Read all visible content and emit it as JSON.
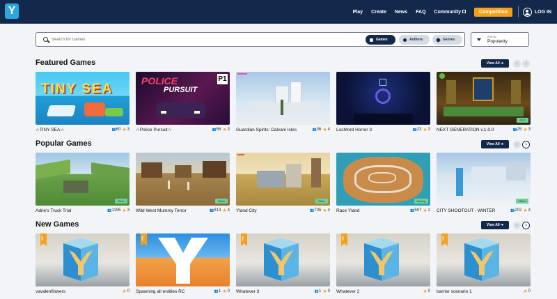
{
  "nav": {
    "logo_letter": "Y",
    "items": [
      "Play",
      "Create",
      "News",
      "FAQ",
      "Community"
    ],
    "competition": "Competition",
    "login": "LOG IN"
  },
  "search": {
    "placeholder": "Search for Games",
    "filters": [
      "Games",
      "Authors",
      "Genres"
    ],
    "sort_label": "Sort By",
    "sort_value": "Popularity"
  },
  "sections": [
    {
      "title": "Featured Games",
      "view_all": "View All ➔",
      "games": [
        {
          "title": "☆TINY SEA☆",
          "plays": "60",
          "rating": "3",
          "thumb": "tiny-sea"
        },
        {
          "title": "☆Police Pursuit☆",
          "plays": "56",
          "rating": "3",
          "thumb": "police"
        },
        {
          "title": "Guardian Spirits: Dalvani Isles",
          "plays": "36",
          "rating": "4",
          "thumb": "guardian"
        },
        {
          "title": "Lochford Horror 3",
          "plays": "23",
          "rating": "3",
          "thumb": "lochford"
        },
        {
          "title": "NEXT GENERATION v.1.0.0",
          "plays": "25",
          "rating": "3",
          "tag": "RPG",
          "thumb": "nextgen"
        }
      ]
    },
    {
      "title": "Popular Games",
      "view_all": "View All ➔",
      "games": [
        {
          "title": "Adrie's Truck Trial",
          "plays": "1195",
          "rating": "3",
          "tag": "Other",
          "thumb": "truck"
        },
        {
          "title": "Wild West Mummy Terror",
          "plays": "813",
          "rating": "4",
          "tag": "Other",
          "thumb": "wildwest"
        },
        {
          "title": "Yland City",
          "plays": "705",
          "rating": "4",
          "tag": "Other",
          "thumb": "ylandcity"
        },
        {
          "title": "Race Yland",
          "plays": "597",
          "rating": "2",
          "tag": "Racing",
          "thumb": "race"
        },
        {
          "title": "CITY SHOOTOUT - WINTER",
          "plays": "202",
          "rating": "4",
          "tag": "Other",
          "thumb": "winter"
        }
      ]
    },
    {
      "title": "New Games",
      "view_all": "View All ➔",
      "games": [
        {
          "title": "vavalenflowers",
          "plays": "",
          "rating": "0",
          "badge": "NEW",
          "thumb": "ynew"
        },
        {
          "title": "Spawning all entities RC",
          "plays": "1",
          "rating": "0",
          "badge": "NEW",
          "thumb": "ybig"
        },
        {
          "title": "Whatever 3",
          "plays": "1",
          "rating": "0",
          "badge": "NEW",
          "thumb": "ynew"
        },
        {
          "title": "Whatever 2",
          "plays": "",
          "rating": "0",
          "badge": "NEW",
          "thumb": "ynew"
        },
        {
          "title": "barrier scenario 1",
          "plays": "",
          "rating": "0",
          "badge": "NEW",
          "thumb": "ynew"
        }
      ]
    }
  ]
}
